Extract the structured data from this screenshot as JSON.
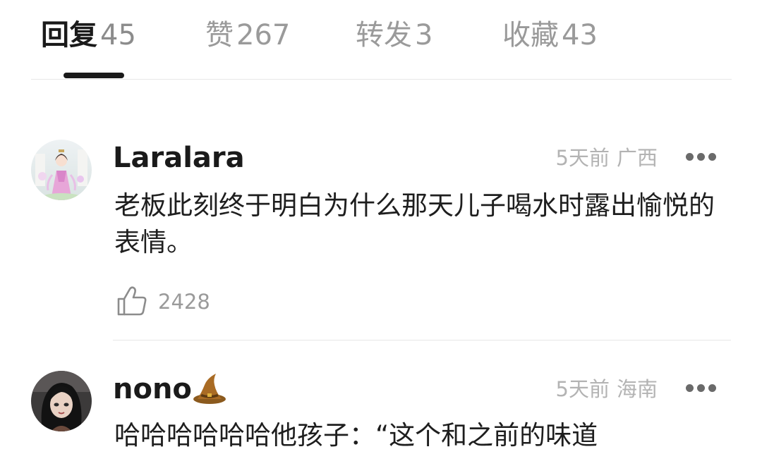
{
  "tabs": [
    {
      "label": "回复",
      "count": "45"
    },
    {
      "label": "赞",
      "count": "267"
    },
    {
      "label": "转发",
      "count": "3"
    },
    {
      "label": "收藏",
      "count": "43"
    }
  ],
  "comments": [
    {
      "username": "Laralara",
      "time": "5天前",
      "region": "广西",
      "text": "老板此刻终于明白为什么那天儿子喝水时露出愉悦的表情。",
      "likes": "2428"
    },
    {
      "username": "nono",
      "badge_icon": "wizard-hat-icon",
      "time": "5天前",
      "region": "海南",
      "text": "哈哈哈哈哈哈他孩子：“这个和之前的味道"
    }
  ],
  "colors": {
    "primary_text": "#1a1a1a",
    "secondary_text": "#9a9a9a",
    "divider": "#e6e6e6"
  }
}
